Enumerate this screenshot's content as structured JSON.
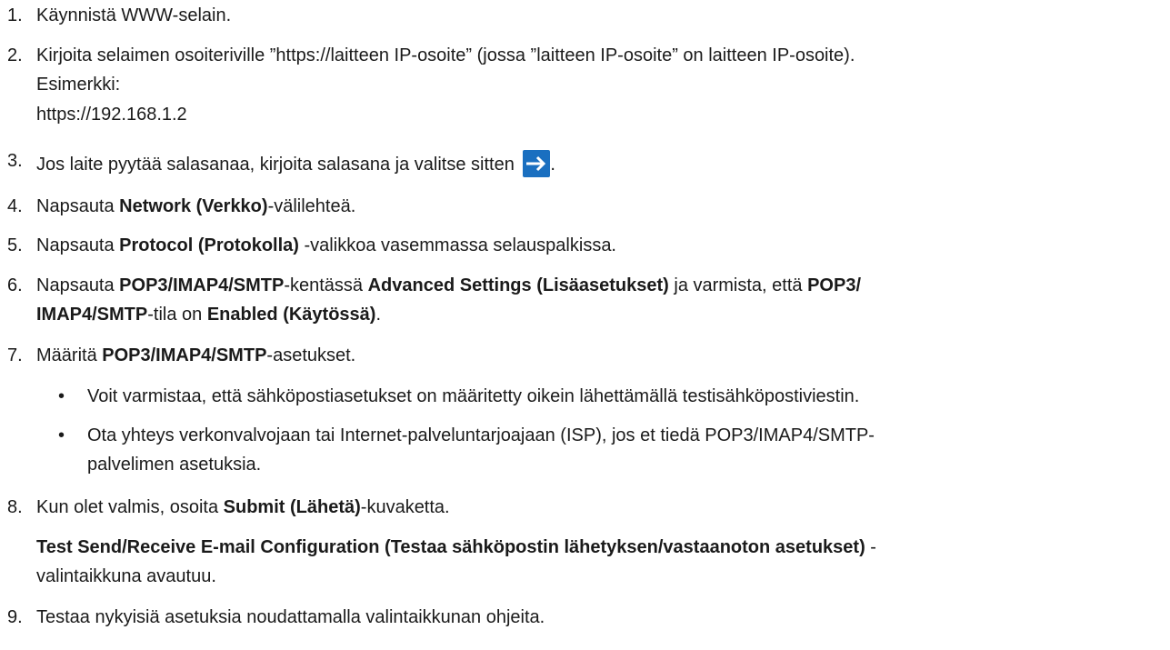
{
  "steps": [
    {
      "n": "1.",
      "text": "Käynnistä WWW-selain."
    },
    {
      "n": "2.",
      "text": "Kirjoita selaimen osoiteriville ”https://laitteen IP-osoite” (jossa ”laitteen IP-osoite” on laitteen IP-osoite).",
      "example_label": "Esimerkki:",
      "example_value": "https://192.168.1.2"
    },
    {
      "n": "3.",
      "text": "Jos laite pyytää salasanaa, kirjoita salasana ja valitse sitten",
      "icon": "arrow-right-icon",
      "after": "."
    },
    {
      "n": "4.",
      "pre": "Napsauta ",
      "bold": "Network (Verkko)",
      "post": "-välilehteä."
    },
    {
      "n": "5.",
      "pre": "Napsauta ",
      "bold": "Protocol (Protokolla)",
      "post": " -valikkoa vasemmassa selauspalkissa."
    },
    {
      "n": "6.",
      "a": "Napsauta ",
      "b": "POP3/IMAP4/SMTP",
      "c": "-kentässä ",
      "d": "Advanced Settings (Lisäasetukset)",
      "e": " ja varmista, että ",
      "f": "POP3/",
      "g": "IMAP4/SMTP",
      "h": "-tila on ",
      "i": "Enabled (Käytössä)",
      "j": "."
    },
    {
      "n": "7.",
      "pre": "Määritä ",
      "bold": "POP3/IMAP4/SMTP",
      "post": "-asetukset.",
      "bullets": [
        "Voit varmistaa, että sähköpostiasetukset on määritetty oikein lähettämällä testisähköpostiviestin.",
        "Ota yhteys verkonvalvojaan tai Internet-palveluntarjoajaan (ISP), jos et tiedä POP3/IMAP4/SMTP-",
        "palvelimen asetuksia."
      ]
    },
    {
      "n": "8.",
      "pre": "Kun olet valmis, osoita ",
      "bold": "Submit (Lähetä)",
      "post": "-kuvaketta.",
      "dialog_bold": "Test Send/Receive E-mail Configuration (Testaa sähköpostin lähetyksen/vastaanoton asetukset)",
      "dialog_tail": " -",
      "dialog_line2": "valintaikkuna avautuu."
    },
    {
      "n": "9.",
      "text": "Testaa nykyisiä asetuksia noudattamalla valintaikkunan ohjeita."
    }
  ],
  "bullet_char": "•"
}
